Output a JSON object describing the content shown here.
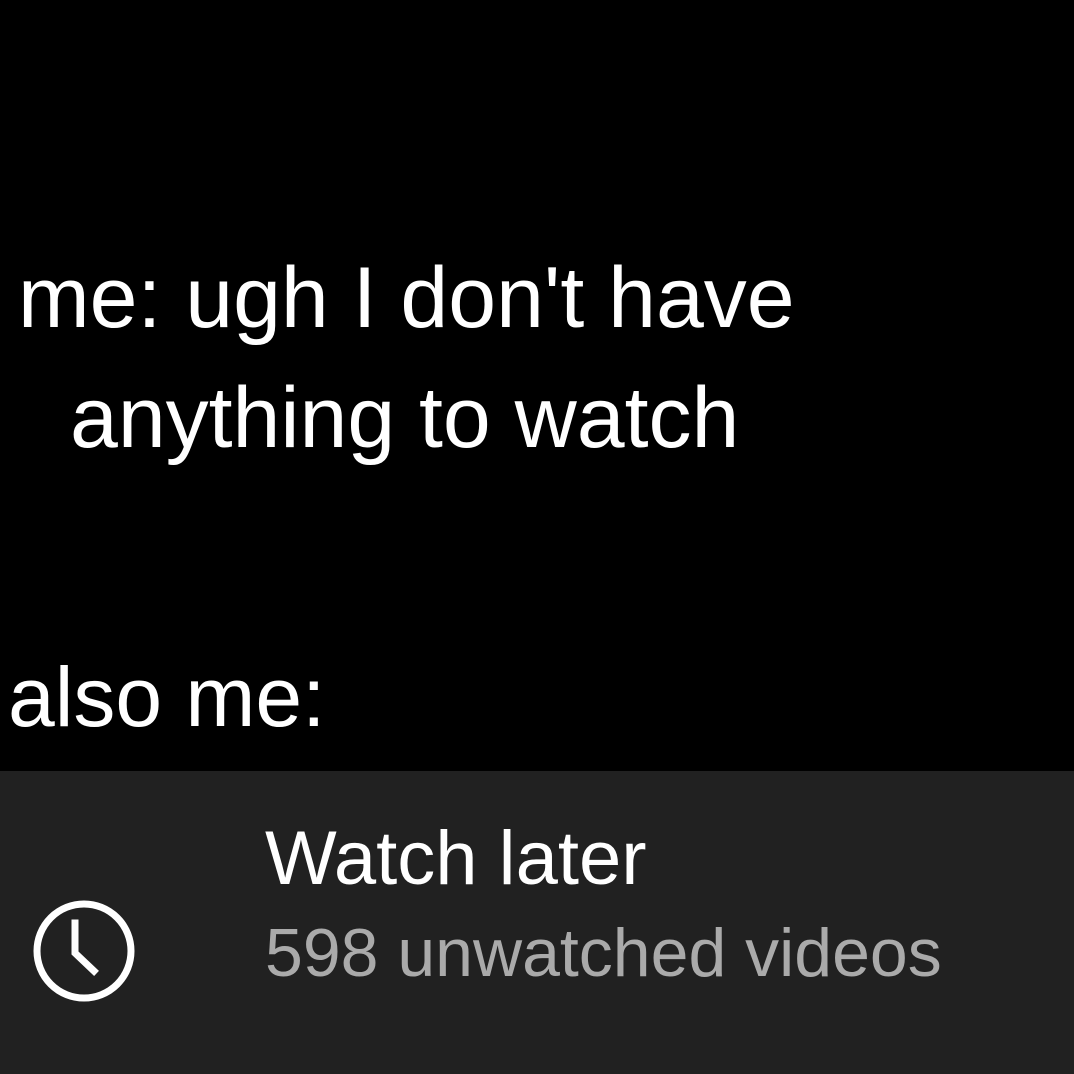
{
  "meme": {
    "line1": "me: ugh I don't have",
    "line2": "anything to watch",
    "line3": "also me:"
  },
  "playlist_row": {
    "icon": "clock-icon",
    "title": "Watch later",
    "subtitle": "598 unwatched videos"
  },
  "colors": {
    "background": "#000000",
    "row_background": "#212121",
    "text_primary": "#ffffff",
    "text_secondary": "#aaaaaa"
  }
}
